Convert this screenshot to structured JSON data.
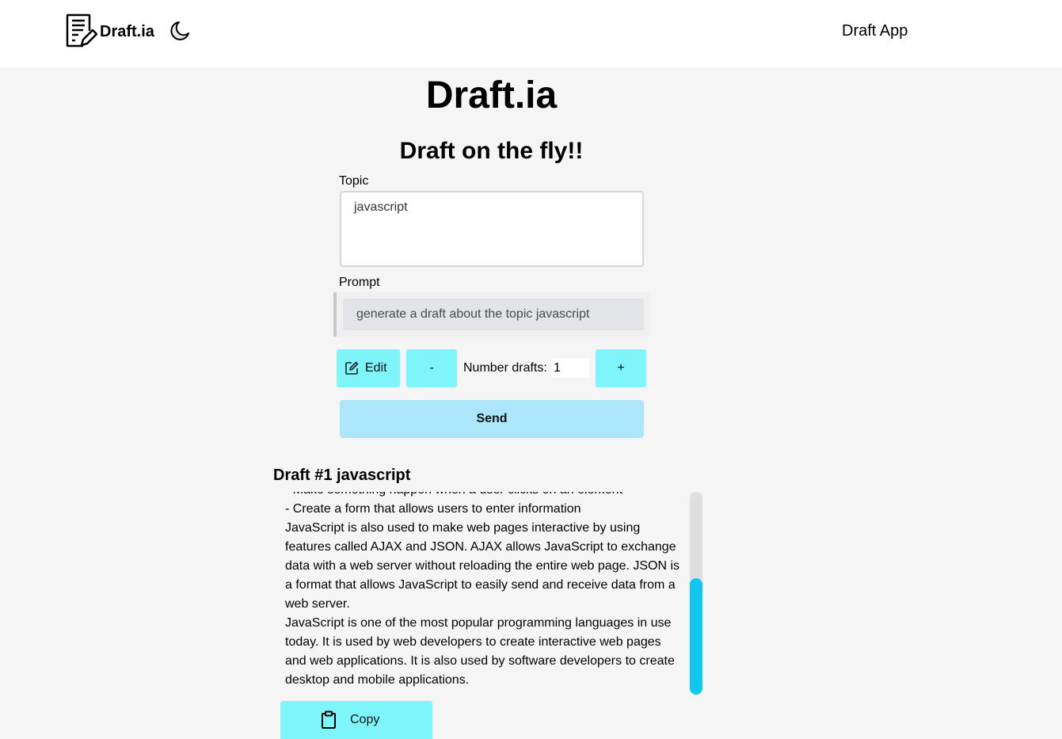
{
  "navbar": {
    "brand": "Draft.ia",
    "brand_icon": "document-edit-icon",
    "theme_toggle_icon": "moon-icon",
    "link": "Draft App"
  },
  "main": {
    "title": "Draft.ia",
    "subtitle": "Draft on the fly!!"
  },
  "form": {
    "topic_label": "Topic",
    "topic_value": "javascript",
    "prompt_label": "Prompt",
    "prompt_value": "generate a draft about the topic javascript",
    "edit_label": "Edit",
    "edit_icon": "edit-icon",
    "decrement_label": "-",
    "number_drafts_label": "Number drafts:",
    "number_drafts_value": "1",
    "increment_label": "+",
    "send_label": "Send"
  },
  "draft": {
    "title": "Draft #1 javascript",
    "text": "- Make something happen when a user clicks on an element\n- Create a form that allows users to enter information\nJavaScript is also used to make web pages interactive by using features called AJAX and JSON. AJAX allows JavaScript to exchange data with a web server without reloading the entire web page. JSON is a format that allows JavaScript to easily send and receive data from a web server.\nJavaScript is one of the most popular programming languages in use today. It is used by web developers to create interactive web pages and web applications. It is also used by software developers to create desktop and mobile applications.",
    "copy_label": "Copy",
    "copy_icon": "clipboard-icon"
  },
  "colors": {
    "accent": "#7ef4fb",
    "send_button": "#abe6fb",
    "scroll_thumb": "#10c8ef",
    "background": "#f5f5f5"
  }
}
